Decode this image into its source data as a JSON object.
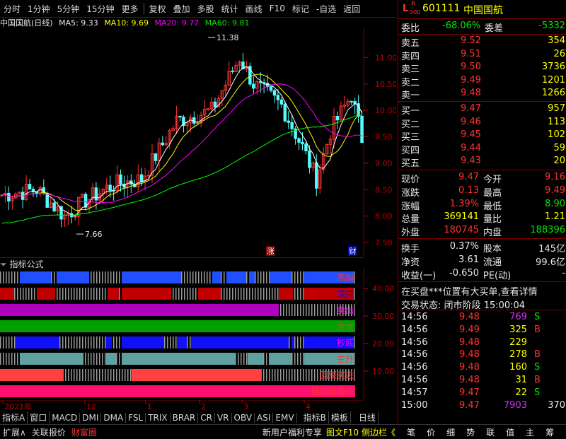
{
  "topbar": {
    "items": [
      "分时",
      "1分钟",
      "5分钟",
      "15分钟",
      "更多",
      "复权",
      "叠加",
      "多股",
      "统计",
      "画线",
      "F10",
      "标记",
      "-自选",
      "返回"
    ]
  },
  "chart_header": {
    "name": "中国国航(日线)",
    "ma5": "MA5: 9.33",
    "ma10": "MA10: 9.69",
    "ma20": "MA20: 9.77",
    "ma60": "MA60: 9.81"
  },
  "chart_data": [
    {
      "type": "line",
      "yticks": [
        "11.00",
        "10.50",
        "10.00",
        "9.50",
        "9.00",
        "8.50",
        "8.00",
        "7.50"
      ],
      "ylim": [
        7.3,
        11.5
      ],
      "annotations": [
        "11.38",
        "7.66"
      ],
      "markers": [
        "涨",
        "财"
      ],
      "xticks": [
        "2021年",
        "12",
        "1",
        "2",
        "3",
        "4"
      ]
    }
  ],
  "indicator": {
    "title": "指标公式",
    "yticks": [
      "40.00",
      "30.00",
      "20.00",
      "10.00"
    ],
    "bands": [
      "高抛",
      "买进",
      "卖出",
      "全仓",
      "抄底",
      "主升",
      "回踩买进",
      "回踩低吸价"
    ]
  },
  "tabs": [
    "指标A",
    "窗口",
    "MACD",
    "DMI",
    "DMA",
    "FSL",
    "TRIX",
    "BRAR",
    "CR",
    "VR",
    "OBV",
    "ASI",
    "EMV",
    "指标B",
    "模板",
    "日线"
  ],
  "quote": {
    "code": "601111",
    "name": "中国国航",
    "badge_top": "R",
    "badge_bottom": "300",
    "badge_left": "L",
    "weibi_label": "委比",
    "weibi": "-68.06%",
    "weicha_label": "委差",
    "weicha": "-5332",
    "asks": [
      {
        "label": "卖五",
        "price": "9.52",
        "vol": "354"
      },
      {
        "label": "卖四",
        "price": "9.51",
        "vol": "26"
      },
      {
        "label": "卖三",
        "price": "9.50",
        "vol": "3736"
      },
      {
        "label": "卖二",
        "price": "9.49",
        "vol": "1201"
      },
      {
        "label": "卖一",
        "price": "9.48",
        "vol": "1266"
      }
    ],
    "bids": [
      {
        "label": "买一",
        "price": "9.47",
        "vol": "957"
      },
      {
        "label": "买二",
        "price": "9.46",
        "vol": "113"
      },
      {
        "label": "买三",
        "price": "9.45",
        "vol": "102"
      },
      {
        "label": "买四",
        "price": "9.44",
        "vol": "59"
      },
      {
        "label": "买五",
        "price": "9.43",
        "vol": "20"
      }
    ],
    "stats": [
      {
        "l1": "现价",
        "v1": "9.47",
        "l2": "今开",
        "v2": "9.16"
      },
      {
        "l1": "涨跌",
        "v1": "0.13",
        "l2": "最高",
        "v2": "9.49"
      },
      {
        "l1": "涨幅",
        "v1": "1.39%",
        "l2": "最低",
        "v2": "8.90"
      },
      {
        "l1": "总量",
        "v1": "369141",
        "l2": "量比",
        "v2": "1.21"
      },
      {
        "l1": "外盘",
        "v1": "180745",
        "l2": "内盘",
        "v2": "188396"
      }
    ],
    "stats2": [
      {
        "l1": "换手",
        "v1": "0.37%",
        "l2": "股本",
        "v2": "145亿"
      },
      {
        "l1": "净资",
        "v1": "3.61",
        "l2": "流通",
        "v2": "99.6亿"
      },
      {
        "l1": "收益(一)",
        "v1": "-0.650",
        "l2": "PE(动)",
        "v2": "-"
      }
    ],
    "notice": "在买盘***位置有大买单,查看详情",
    "trade_status_label": "交易状态:",
    "trade_status": "闭市阶段",
    "trade_time": "15:00:04",
    "ticks": [
      {
        "t": "14:56",
        "p": "9.48",
        "v": "769",
        "s": "S"
      },
      {
        "t": "14:56",
        "p": "9.49",
        "v": "325",
        "s": "B"
      },
      {
        "t": "14:56",
        "p": "9.48",
        "v": "229",
        "s": ""
      },
      {
        "t": "14:56",
        "p": "9.48",
        "v": "278",
        "s": "B"
      },
      {
        "t": "14:56",
        "p": "9.48",
        "v": "160",
        "s": "S"
      },
      {
        "t": "14:56",
        "p": "9.48",
        "v": "31",
        "s": "B"
      },
      {
        "t": "14:57",
        "p": "9.47",
        "v": "22",
        "s": "S"
      },
      {
        "t": "15:00",
        "p": "9.47",
        "v": "7903",
        "s": "",
        "n": "370"
      }
    ]
  },
  "statusbar": {
    "left": [
      "扩展∧",
      "关联报价",
      "财富圈"
    ],
    "middle": [
      "新用户福利专享",
      "图文F10",
      "侧边栏《"
    ],
    "right": [
      "笔",
      "价",
      "细",
      "势",
      "联",
      "值",
      "主",
      "筹"
    ]
  }
}
